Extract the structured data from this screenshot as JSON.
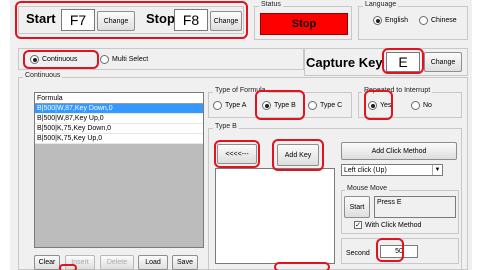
{
  "hotkeys": {
    "start_label": "Start",
    "start_key": "F7",
    "start_change": "Change",
    "stop_label": "Stop",
    "stop_key": "F8",
    "stop_change": "Change"
  },
  "status": {
    "title": "Status",
    "value": "Stop",
    "color": "#ff0000"
  },
  "language": {
    "title": "Language",
    "options": [
      "English",
      "Chinese"
    ],
    "selected": "English"
  },
  "mode": {
    "options": [
      "Continuous",
      "Multi Select"
    ],
    "selected": "Continuous"
  },
  "capture": {
    "label": "Capture Key",
    "key": "E",
    "change": "Change"
  },
  "continuous": {
    "title": "Continuous",
    "list_header": "Formula",
    "rows": [
      "B|500|W,87,Key Down,0",
      "B|500|W,87,Key Up,0",
      "B|500|K,75,Key Down,0",
      "B|500|K,75,Key Up,0"
    ],
    "selected_row": 0,
    "buttons": [
      "Clear",
      "Insert",
      "Delete",
      "Load",
      "Save"
    ]
  },
  "formula_type": {
    "title": "Type of Formula",
    "options": [
      "Type A",
      "Type B",
      "Type C"
    ],
    "selected": "Type B"
  },
  "repeat": {
    "title": "Repeated to Interrupt",
    "options": [
      "Yes",
      "No"
    ],
    "selected": "Yes"
  },
  "type_b": {
    "title": "Type B",
    "arrow_button": "<<<<---",
    "add_key": "Add Key",
    "add_click": "Add Click Method",
    "click_select": "Left click (Up)"
  },
  "mouse_move": {
    "title": "Mouse Move",
    "start": "Start",
    "press_text": "Press E",
    "with_click": "With Click Method",
    "with_click_checked": true,
    "second_label": "Second",
    "second_value": "50"
  },
  "accent": {
    "highlight": "#e0131f",
    "selection": "#3399ff"
  }
}
